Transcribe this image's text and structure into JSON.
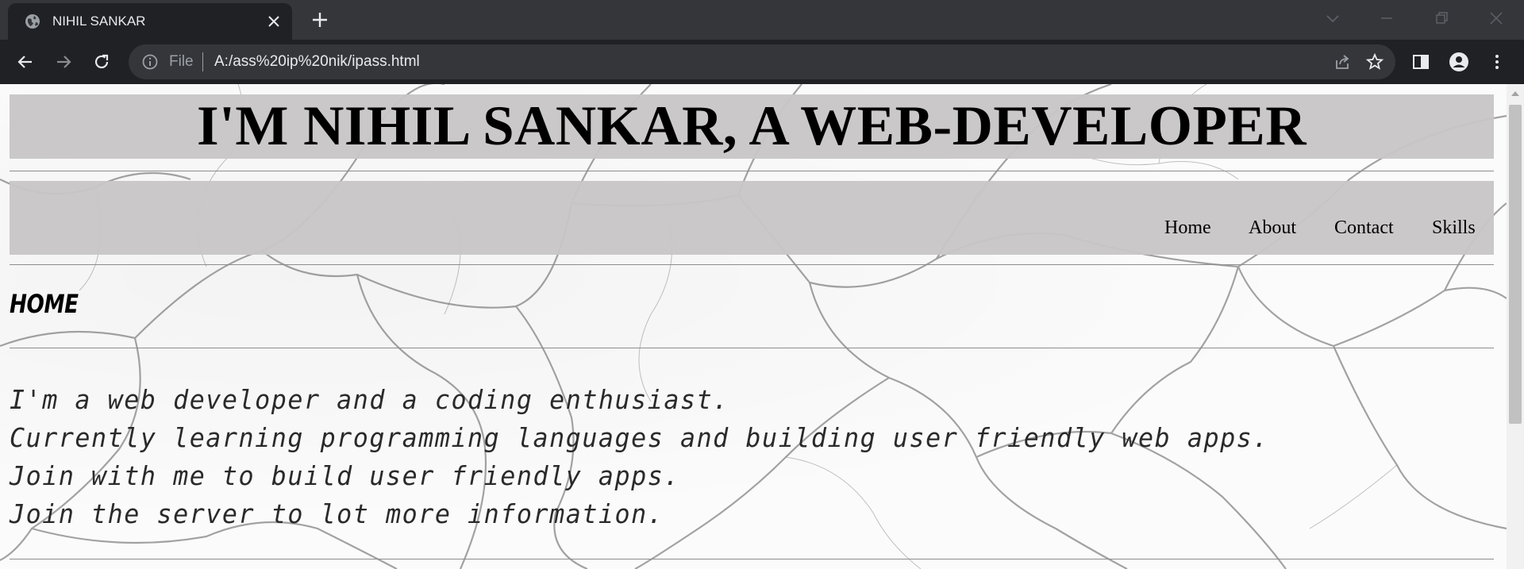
{
  "browser": {
    "tab_title": "NIHIL SANKAR",
    "scheme_label": "File",
    "url": "A:/ass%20ip%20nik/ipass.html",
    "icons": [
      "globe-icon",
      "close-icon",
      "plus-icon",
      "chevron-down-icon",
      "minimize-icon",
      "restore-icon",
      "window-close-icon",
      "back-arrow-icon",
      "forward-arrow-icon",
      "reload-icon",
      "info-icon",
      "share-icon",
      "star-icon",
      "side-panel-icon",
      "profile-icon",
      "kebab-menu-icon"
    ]
  },
  "page": {
    "header_title": "I'M NIHIL SANKAR, A WEB-DEVELOPER",
    "nav": [
      {
        "label": "Home"
      },
      {
        "label": "About"
      },
      {
        "label": "Contact"
      },
      {
        "label": "Skills"
      }
    ],
    "section_title": "HOME",
    "intro_lines": [
      "I'm a web developer and a coding enthusiast.",
      "Currently learning programming languages and building user friendly web apps.",
      "Join with me to build user friendly apps.",
      "Join the server to lot more information."
    ]
  },
  "colors": {
    "chrome_dark": "#202124",
    "tabstrip": "#35363a",
    "banner_gray": "#c8c6c7",
    "text": "#000000"
  }
}
